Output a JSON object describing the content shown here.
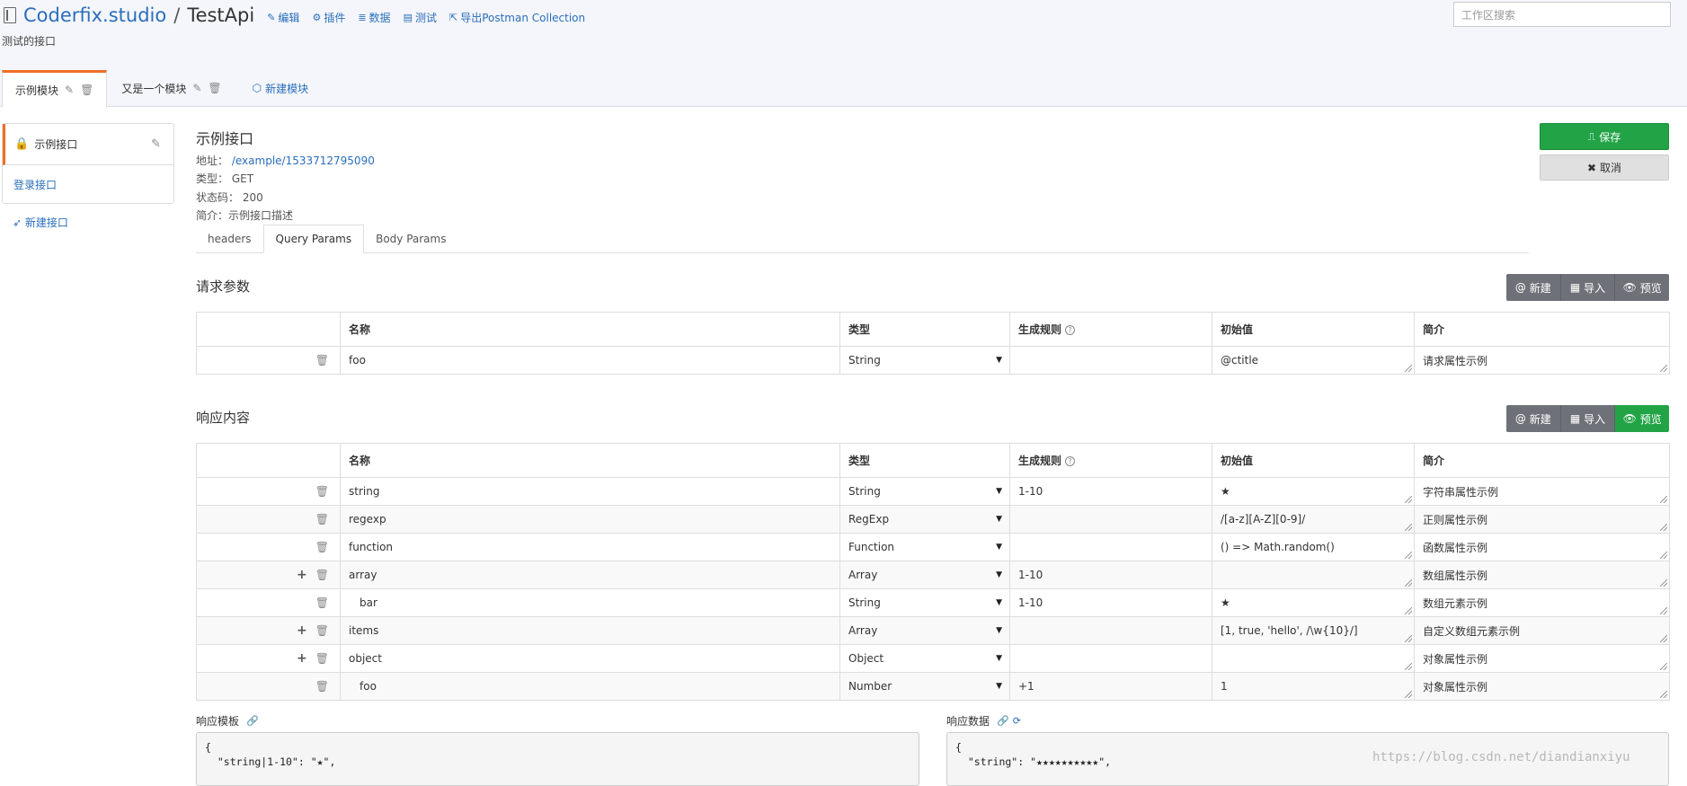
{
  "header": {
    "org": "Coderfix.studio",
    "separator": "/",
    "repo": "TestApi",
    "actions": [
      {
        "icon": "pencil-icon",
        "label": "编辑"
      },
      {
        "icon": "plugin-icon",
        "label": "插件"
      },
      {
        "icon": "database-icon",
        "label": "数据"
      },
      {
        "icon": "test-icon",
        "label": "测试"
      },
      {
        "icon": "export-icon",
        "label": "导出Postman Collection"
      }
    ],
    "description": "测试的接口",
    "search_placeholder": "工作区搜索"
  },
  "modules": {
    "tabs": [
      {
        "label": "示例模块",
        "active": true
      },
      {
        "label": "又是一个模块",
        "active": false
      }
    ],
    "new_label": "新建模块"
  },
  "sidebar": {
    "items": [
      {
        "label": "示例接口",
        "active": true
      },
      {
        "label": "登录接口",
        "active": false
      }
    ],
    "new_label": "新建接口"
  },
  "api": {
    "title": "示例接口",
    "url_label": "地址：",
    "url": "/example/1533712795090",
    "type_label": "类型：",
    "type": "GET",
    "status_label": "状态码：",
    "status": "200",
    "desc_label": "简介：",
    "desc": "示例接口描述"
  },
  "buttons": {
    "save": "保存",
    "cancel": "取消"
  },
  "param_tabs": [
    "headers",
    "Query Params",
    "Body Params"
  ],
  "request": {
    "title": "请求参数",
    "group": {
      "new": "新建",
      "import": "导入",
      "preview": "预览"
    },
    "columns": [
      "名称",
      "类型",
      "生成规则",
      "初始值",
      "简介"
    ],
    "rows": [
      {
        "name": "foo",
        "type": "String",
        "rule": "",
        "value": "@ctitle",
        "desc": "请求属性示例",
        "plus": false,
        "indent": false
      }
    ]
  },
  "response": {
    "title": "响应内容",
    "group": {
      "new": "新建",
      "import": "导入",
      "preview": "预览"
    },
    "columns": [
      "名称",
      "类型",
      "生成规则",
      "初始值",
      "简介"
    ],
    "rows": [
      {
        "name": "string",
        "type": "String",
        "rule": "1-10",
        "value": "★",
        "desc": "字符串属性示例",
        "plus": false,
        "indent": false
      },
      {
        "name": "regexp",
        "type": "RegExp",
        "rule": "",
        "value": "/[a-z][A-Z][0-9]/",
        "desc": "正则属性示例",
        "plus": false,
        "indent": false
      },
      {
        "name": "function",
        "type": "Function",
        "rule": "",
        "value": "() => Math.random()",
        "desc": "函数属性示例",
        "plus": false,
        "indent": false
      },
      {
        "name": "array",
        "type": "Array",
        "rule": "1-10",
        "value": "",
        "desc": "数组属性示例",
        "plus": true,
        "indent": false
      },
      {
        "name": "bar",
        "type": "String",
        "rule": "1-10",
        "value": "★",
        "desc": "数组元素示例",
        "plus": false,
        "indent": true
      },
      {
        "name": "items",
        "type": "Array",
        "rule": "",
        "value": "[1, true, 'hello', /\\w{10}/]",
        "desc": "自定义数组元素示例",
        "plus": true,
        "indent": false
      },
      {
        "name": "object",
        "type": "Object",
        "rule": "",
        "value": "",
        "desc": "对象属性示例",
        "plus": true,
        "indent": false
      },
      {
        "name": "foo",
        "type": "Number",
        "rule": "+1",
        "value": "1",
        "desc": "对象属性示例",
        "plus": false,
        "indent": true
      }
    ]
  },
  "template": {
    "label": "响应模板",
    "code": "{\n  \"string|1-10\": \"★\","
  },
  "data_view": {
    "label": "响应数据",
    "code": "{\n  \"string\": \"★★★★★★★★★★\","
  },
  "watermark": "https://blog.csdn.net/diandianxiyu"
}
